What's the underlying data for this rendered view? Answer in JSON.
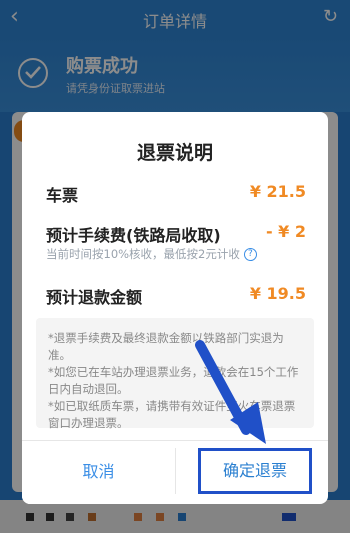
{
  "topbar": {
    "title": "订单详情",
    "back_glyph": "‹",
    "refresh_glyph": "↻"
  },
  "banner": {
    "status": "购票成功",
    "hint": "请凭身份证取票进站"
  },
  "dialog": {
    "title": "退票说明",
    "rows": [
      {
        "label": "车票",
        "value": "¥ 21.5"
      },
      {
        "label": "预计手续费(铁路局收取)",
        "value": "- ¥ 2"
      },
      {
        "label": "预计退款金额",
        "value": "¥ 19.5"
      }
    ],
    "fee_hint": "当前时间按10%核收，最低按2元计收",
    "notes": [
      "*退票手续费及最终退款金额以铁路部门实退为准。",
      "*如您已在车站办理退票业务，退款会在15个工作日内自动退回。",
      "*如已取纸质车票，请携带有效证件至火车票退票窗口办理退票。"
    ],
    "cancel_label": "取消",
    "confirm_label": "确定退票"
  },
  "colors": {
    "accent_blue": "#2a7fd0",
    "price_orange": "#f08a24",
    "highlight_box": "#2050c8"
  }
}
